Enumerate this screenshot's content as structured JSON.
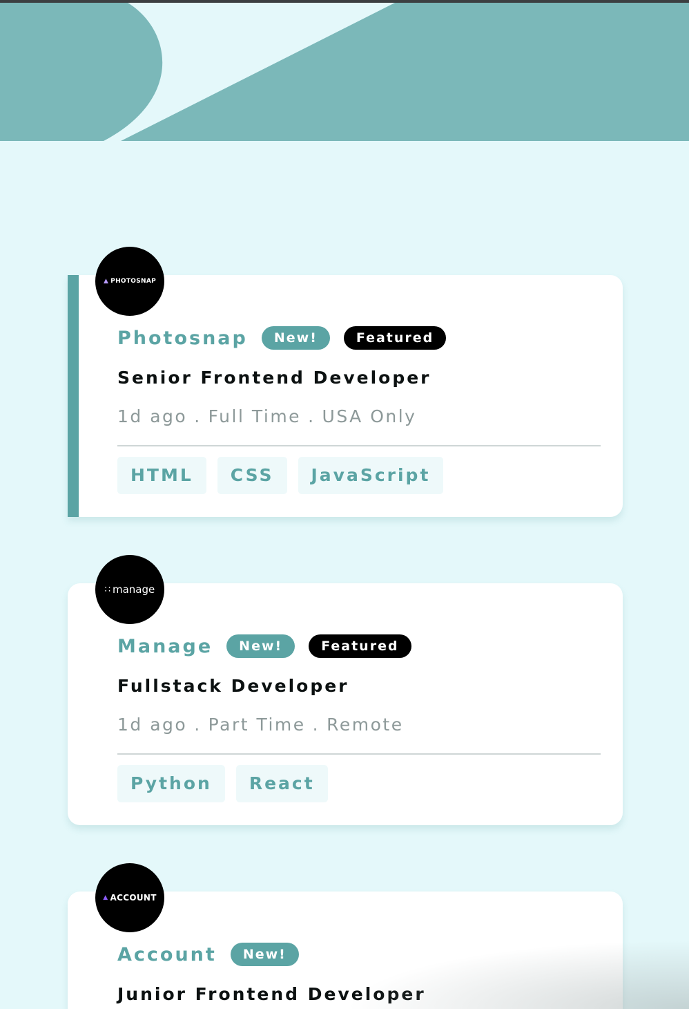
{
  "colors": {
    "accent": "#5ba4a4",
    "header": "#7bb8b9",
    "background": "#e4f8fa",
    "badge_dark": "#000000",
    "tag_bg": "#eef9fa",
    "meta_text": "#8d9999"
  },
  "jobs": [
    {
      "logo_text": "PHOTOSNAP",
      "logo_icon": "triangle-icon",
      "company": "Photosnap",
      "new_label": "New!",
      "featured_label": "Featured",
      "title": "Senior Frontend Developer",
      "posted": "1d ago",
      "contract": "Full Time",
      "location": "USA Only",
      "tags": [
        "HTML",
        "CSS",
        "JavaScript"
      ]
    },
    {
      "logo_text": "manage",
      "logo_icon": "dots-icon",
      "company": "Manage",
      "new_label": "New!",
      "featured_label": "Featured",
      "title": "Fullstack Developer",
      "posted": "1d ago",
      "contract": "Part Time",
      "location": "Remote",
      "tags": [
        "Python",
        "React"
      ]
    },
    {
      "logo_text": "ACCOUNT",
      "logo_icon": "triangle-icon",
      "company": "Account",
      "new_label": "New!",
      "title": "Junior Frontend Developer"
    }
  ],
  "meta_separator": "."
}
